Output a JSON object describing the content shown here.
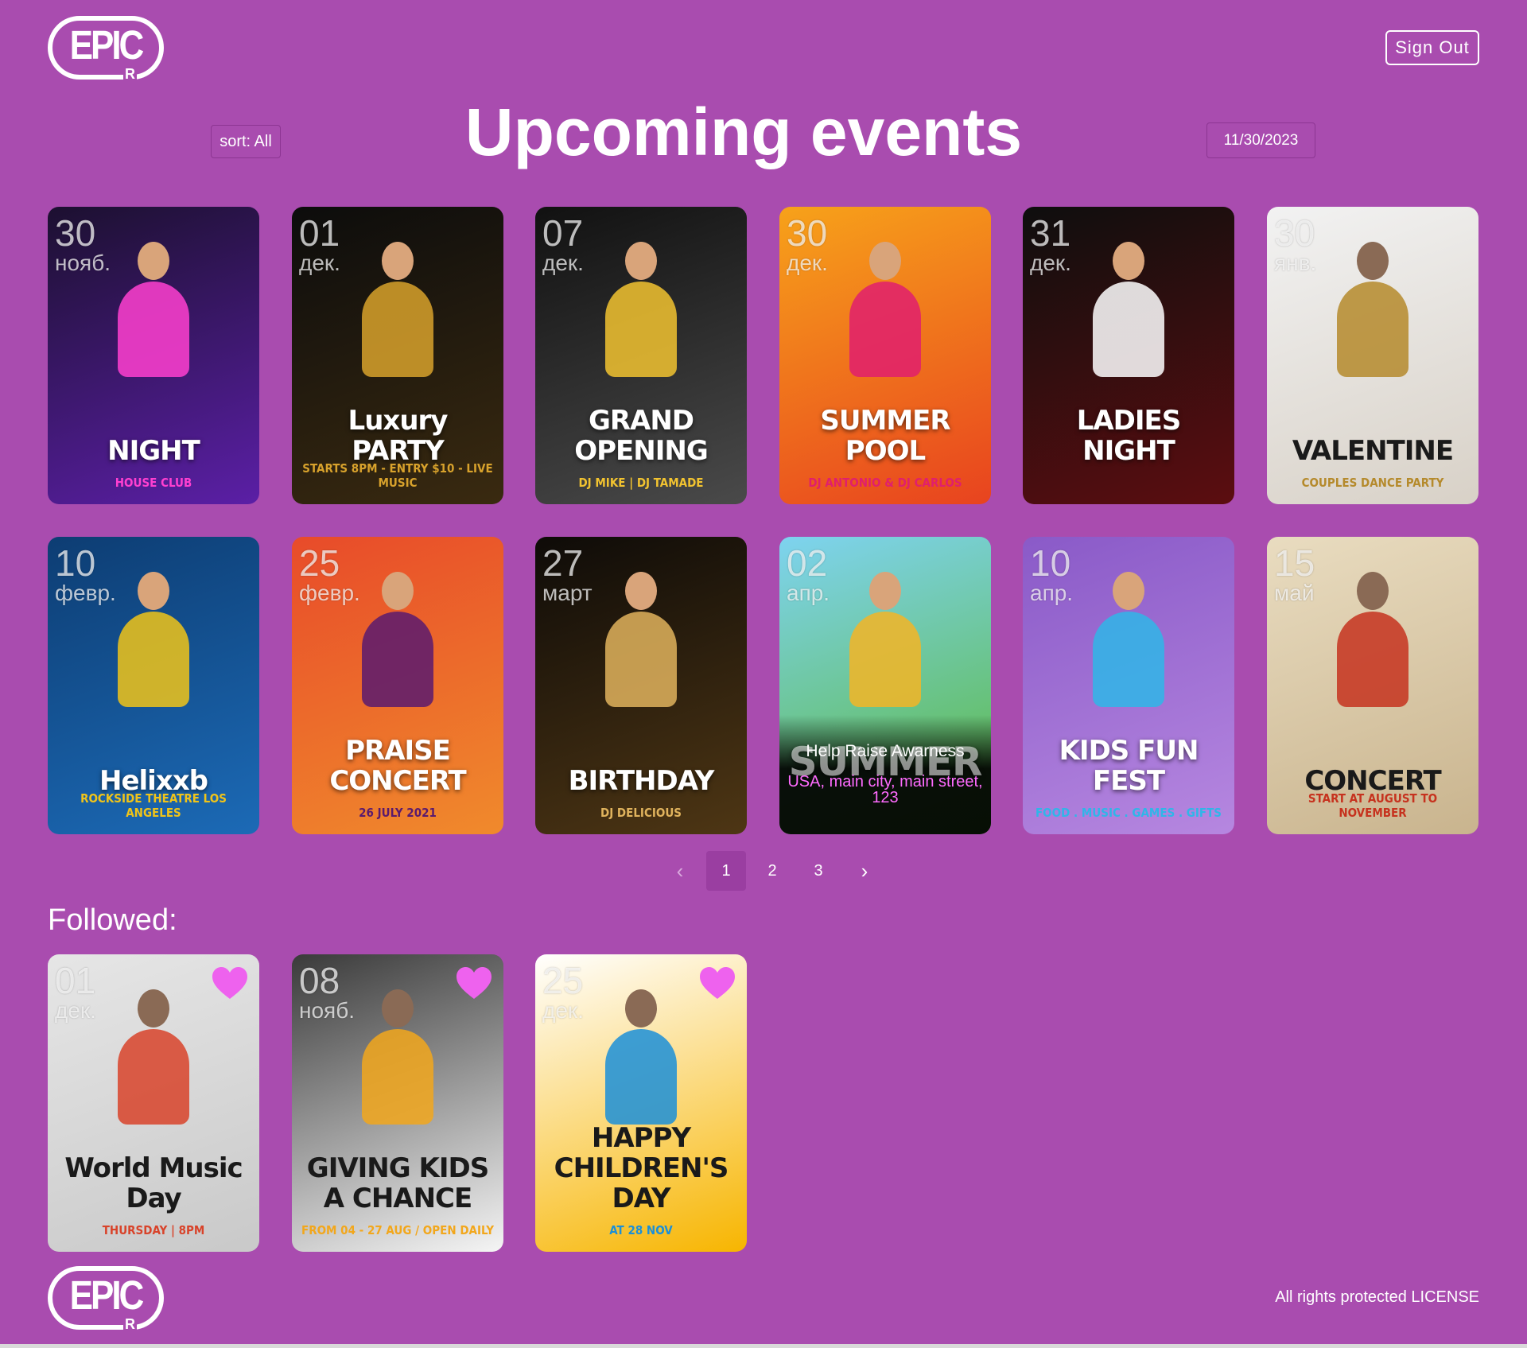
{
  "header": {
    "logo_text": "EPIC",
    "logo_sub": "R",
    "signout_label": "Sign Out",
    "title": "Upcoming events",
    "sort_label": "sort: All",
    "date_value": "11/30/2023"
  },
  "events": [
    {
      "day": "30",
      "month": "нояб.",
      "title": "NIGHT",
      "subtitle": "HOUSE CLUB",
      "colors": [
        "#1c1030",
        "#5b1fa6"
      ],
      "accent": "#ff3fd0"
    },
    {
      "day": "01",
      "month": "дек.",
      "title": "Luxury PARTY",
      "subtitle": "STARTS 8PM - ENTRY $10 - LIVE MUSIC",
      "colors": [
        "#0c0c0c",
        "#3a2a10"
      ],
      "accent": "#d8a22c"
    },
    {
      "day": "07",
      "month": "дек.",
      "title": "GRAND OPENING",
      "subtitle": "DJ MIKE | DJ TAMADE",
      "colors": [
        "#111111",
        "#4a4a4a"
      ],
      "accent": "#f2c330"
    },
    {
      "day": "30",
      "month": "дек.",
      "title": "SUMMER POOL",
      "subtitle": "DJ ANTONIO & DJ CARLOS",
      "colors": [
        "#f7a21a",
        "#e8431f"
      ],
      "accent": "#e01f6d"
    },
    {
      "day": "31",
      "month": "дек.",
      "title": "LADIES NIGHT",
      "subtitle": "",
      "colors": [
        "#0e0e0e",
        "#5c0d10"
      ],
      "accent": "#ffffff"
    },
    {
      "day": "30",
      "month": "янв.",
      "title": "VALENTINE",
      "subtitle": "COUPLES DANCE PARTY",
      "colors": [
        "#f2f2f2",
        "#d8d1c7"
      ],
      "accent": "#b58a2c",
      "dark": true
    },
    {
      "day": "10",
      "month": "февр.",
      "title": "Helixxb",
      "subtitle": "ROCKSIDE THEATRE  LOS ANGELES",
      "colors": [
        "#0d3d73",
        "#1c6ab6"
      ],
      "accent": "#f0c419"
    },
    {
      "day": "25",
      "month": "февр.",
      "title": "PRAISE CONCERT",
      "subtitle": "26 JULY 2021",
      "colors": [
        "#e84b2a",
        "#f08a2c"
      ],
      "accent": "#5a1a6e"
    },
    {
      "day": "27",
      "month": "март",
      "title": "BIRTHDAY",
      "subtitle": "DJ DELICIOUS",
      "colors": [
        "#0e0b08",
        "#4e3614"
      ],
      "accent": "#e0b35d"
    },
    {
      "day": "02",
      "month": "апр.",
      "title": "SUMMER",
      "subtitle": "",
      "colors": [
        "#7ed3f0",
        "#5bb83a"
      ],
      "accent": "#f3b526",
      "overlay": true,
      "overlay_title": "Help Raise Awarness",
      "overlay_address": "USA, main city, main street, 123"
    },
    {
      "day": "10",
      "month": "апр.",
      "title": "KIDS FUN FEST",
      "subtitle": "FOOD . MUSIC . GAMES . GIFTS",
      "colors": [
        "#8a5ac8",
        "#b687e0"
      ],
      "accent": "#2fb6e8"
    },
    {
      "day": "15",
      "month": "май",
      "title": "CONCERT",
      "subtitle": "START AT AUGUST TO NOVEMBER",
      "colors": [
        "#e9dcc0",
        "#c9b48e"
      ],
      "accent": "#c6321e",
      "dark": true
    }
  ],
  "pagination": {
    "pages": [
      "1",
      "2",
      "3"
    ],
    "active": "1",
    "prev": "‹",
    "next": "›"
  },
  "followed": {
    "title": "Followed:",
    "items": [
      {
        "day": "01",
        "month": "дек.",
        "title": "World Music Day",
        "subtitle": "THURSDAY | 8PM",
        "colors": [
          "#e6e6e6",
          "#c9c9c9"
        ],
        "accent": "#d8432a",
        "dark": true
      },
      {
        "day": "08",
        "month": "нояб.",
        "title": "GIVING KIDS A CHANCE",
        "subtitle": "FROM 04 - 27 AUG / OPEN DAILY",
        "colors": [
          "#3a3a3a",
          "#f5f5f5"
        ],
        "accent": "#f2a71c",
        "dark": true
      },
      {
        "day": "25",
        "month": "дек.",
        "title": "HAPPY CHILDREN'S DAY",
        "subtitle": "AT 28 NOV",
        "colors": [
          "#ffffff",
          "#f7b500"
        ],
        "accent": "#1b8fd8",
        "dark": true
      }
    ]
  },
  "footer": {
    "logo_text": "EPIC",
    "logo_sub": "R",
    "text": "All rights protected LICENSE"
  },
  "colors": {
    "background": "#a94caf",
    "heart": "#ee62ee",
    "address": "#ff6bff"
  }
}
